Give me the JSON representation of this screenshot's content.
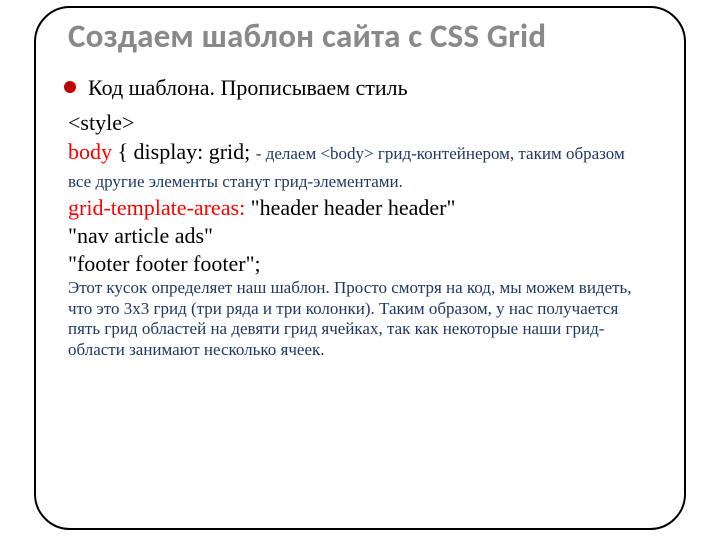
{
  "title": "Создаем шаблон сайта с CSS Grid",
  "bullet": "Код шаблона. Прописываем стиль",
  "code": {
    "style_open": "<style>",
    "body_kw": "body",
    "body_rest": " { display: grid; ",
    "note1": "- делаем <body> грид-контейнером, таким образом все другие элементы станут грид-элементами.",
    "gta_kw": "grid-template-areas:",
    "gta_val1": " \"header header header\"",
    "gta_val2": "\"nav article ads\"",
    "gta_val3": "\"footer footer footer\";",
    "note2": "Этот кусок определяет наш шаблон. Просто смотря на код, мы можем видеть, что это 3x3 грид (три ряда и три колонки). Таким образом, у нас получается пять грид областей на девяти грид ячейках, так как некоторые наши грид-области занимают несколько ячеек."
  }
}
